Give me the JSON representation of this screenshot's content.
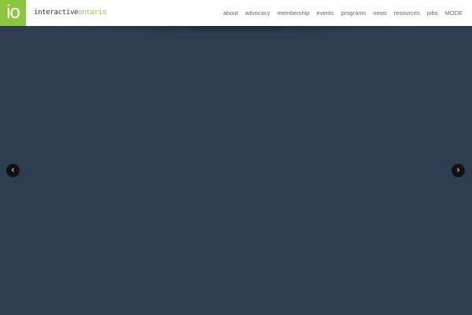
{
  "logo": {
    "mark": "io",
    "word_dark": "interactive",
    "word_green": "ontario",
    "color": "#8cc63f"
  },
  "nav": [
    "about",
    "advocacy",
    "membership",
    "events",
    "programs",
    "news",
    "resources",
    "jobs",
    "MODE"
  ],
  "slider": {
    "background": "#2e3d50",
    "prev_icon": "‹",
    "next_icon": "›"
  }
}
